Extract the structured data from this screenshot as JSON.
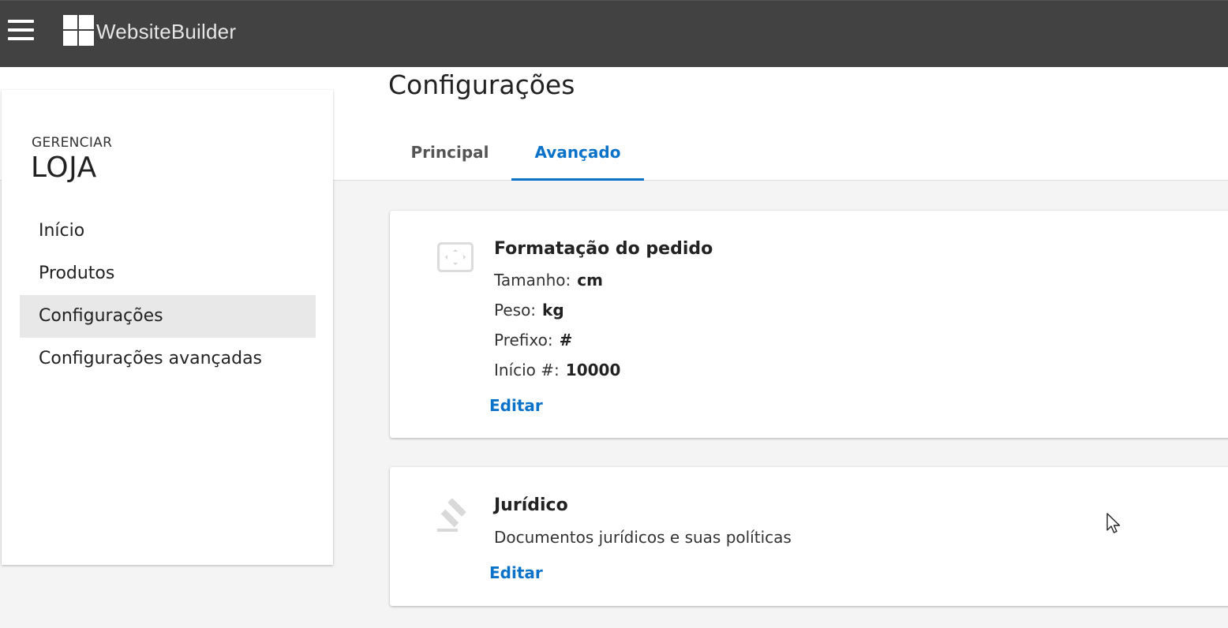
{
  "app": {
    "brand": "WebsiteBuilder"
  },
  "sidebar": {
    "subtitle": "GERENCIAR",
    "title": "LOJA",
    "items": [
      {
        "label": "Início"
      },
      {
        "label": "Produtos"
      },
      {
        "label": "Configurações"
      },
      {
        "label": "Configurações avançadas"
      }
    ],
    "active_index": 2
  },
  "page": {
    "title": "Configurações",
    "tabs": [
      {
        "label": "Principal"
      },
      {
        "label": "Avançado"
      }
    ],
    "active_tab": 1
  },
  "cards": {
    "order_format": {
      "icon": "resize-frame-icon",
      "title": "Formatação do pedido",
      "fields": [
        {
          "label": "Tamanho:",
          "value": "cm"
        },
        {
          "label": "Peso:",
          "value": "kg"
        },
        {
          "label": "Prefixo:",
          "value": "#"
        },
        {
          "label": "Início #:",
          "value": "10000"
        }
      ],
      "edit_label": "Editar"
    },
    "legal": {
      "icon": "gavel-icon",
      "title": "Jurídico",
      "description": "Documentos jurídicos e suas políticas",
      "edit_label": "Editar"
    }
  },
  "colors": {
    "topbar": "#424242",
    "accent": "#0a72c9",
    "active_nav": "#e8e8e8"
  }
}
